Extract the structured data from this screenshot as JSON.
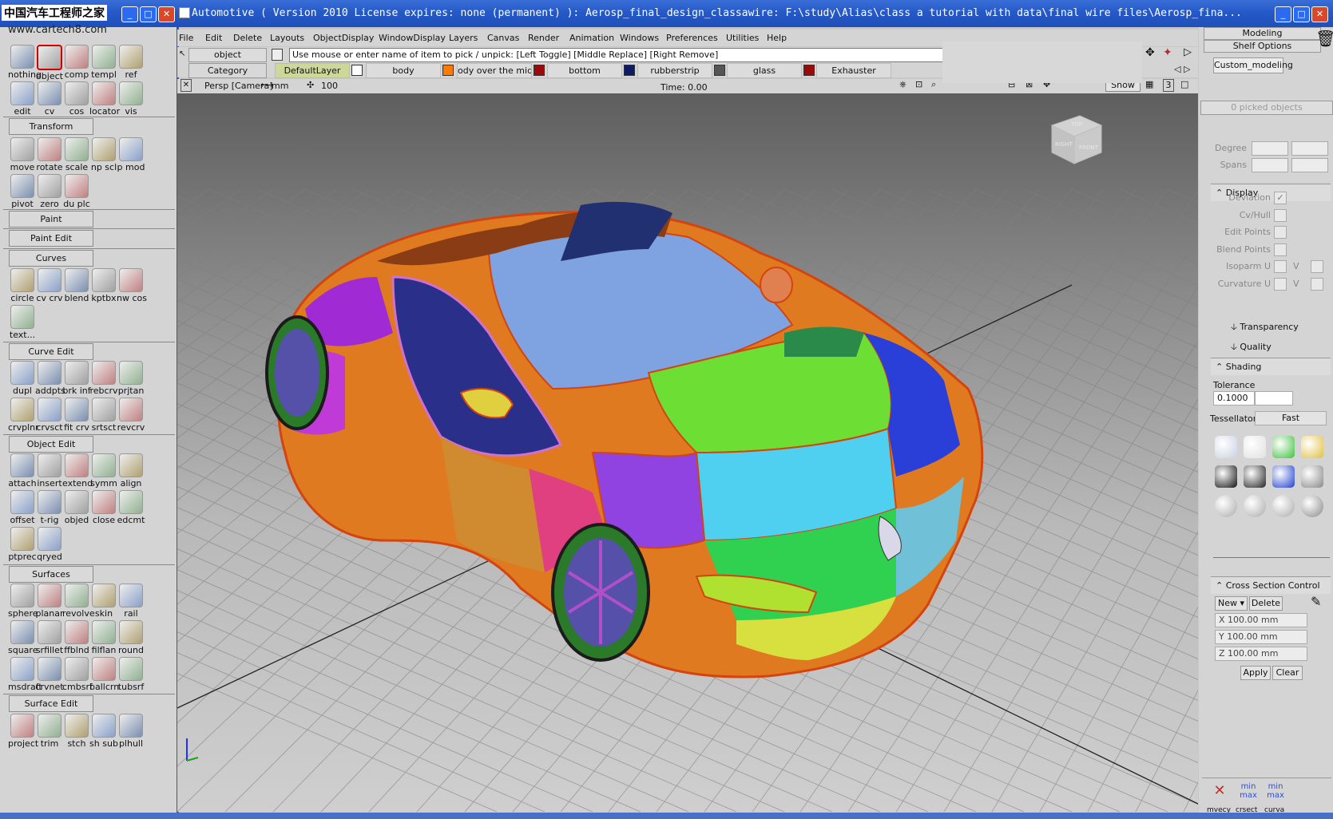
{
  "titlebar": {
    "site_logo": "中国汽车工程师之家",
    "site_url": "www.cartech8.com",
    "title": "Automotive ( Version 2010  License expires: none (permanent) ): Aerosp_final_design_classawire: F:\\study\\Alias\\class a tutorial with data\\final wire files\\Aerosp_fina...",
    "left_controls": [
      "_",
      "□",
      "✕"
    ],
    "right_controls": [
      "_",
      "□",
      "✕"
    ]
  },
  "menubar": [
    "File",
    "Edit",
    "Delete",
    "Layouts",
    "ObjectDisplay",
    "WindowDisplay",
    "Layers",
    "Canvas",
    "Render",
    "Animation",
    "Windows",
    "Preferences",
    "Utilities",
    "Help"
  ],
  "pickbar": {
    "pick_mode": "object",
    "prompt": "Use mouse or enter name of item to pick / unpick: [Left Toggle] [Middle Replace] [Right Remove]"
  },
  "layerbar": {
    "category_label": "Category",
    "layers": [
      {
        "name": "DefaultLayer",
        "color": "#ffffff"
      },
      {
        "name": "body",
        "color": "#ff7a00"
      },
      {
        "name": "ody over the middle",
        "color": "#9b0a0a"
      },
      {
        "name": "bottom",
        "color": "#0d1a66"
      },
      {
        "name": "rubberstrip",
        "color": "#555555"
      },
      {
        "name": "glass",
        "color": "#9b0a0a"
      },
      {
        "name": "Exhauster",
        "color": ""
      }
    ]
  },
  "viewbar": {
    "camera": "Persp [Camera]",
    "unit": "mm",
    "zoom": "100",
    "time": "Time: 0.00",
    "show_button": "Show",
    "page_number": "3"
  },
  "viewcube": {
    "top": "TOP",
    "right": "FRONT",
    "left": "RIGHT"
  },
  "shelf": {
    "groups": [
      {
        "tools": [
          "nothing",
          "object",
          "comp",
          "templ",
          "ref",
          "edit",
          "cv",
          "cos",
          "locator",
          "vis"
        ]
      },
      {
        "header": "Transform",
        "tools": [
          "move",
          "rotate",
          "scale",
          "np scl",
          "p mod",
          "pivot",
          "zero",
          "du plc"
        ]
      },
      {
        "header": "Paint",
        "tools": []
      },
      {
        "header": "Paint Edit",
        "tools": []
      },
      {
        "header": "Curves",
        "tools": [
          "circle",
          "cv crv",
          "blend",
          "kptbx",
          "nw cos",
          "text..."
        ]
      },
      {
        "header": "Curve Edit",
        "tools": [
          "dupl",
          "addpts",
          "brk inf",
          "rebcrv",
          "prjtan",
          "crvplnr",
          "crvsct",
          "fit crv",
          "srtsct",
          "revcrv"
        ]
      },
      {
        "header": "Object Edit",
        "tools": [
          "attach",
          "insert",
          "extend",
          "symm",
          "align",
          "offset",
          "t-rig",
          "objed",
          "close",
          "edcmt",
          "ptprec",
          "qryed"
        ]
      },
      {
        "header": "Surfaces",
        "tools": [
          "sphere",
          "planar",
          "revolve",
          "skin",
          "rail",
          "square",
          "srfillet",
          "ffblnd",
          "filflan",
          "round",
          "msdraft",
          "crvnet",
          "cmbsrf",
          "ballcrn",
          "tubsrf"
        ]
      },
      {
        "header": "Surface Edit",
        "tools": [
          "project",
          "trim",
          "stch",
          "sh sub",
          "plhull"
        ]
      }
    ]
  },
  "rpanel": {
    "tab_top": "Modeling",
    "tab_shelf": "Shelf Options",
    "custom_tab": "Custom_modeling",
    "picked": "0 picked objects",
    "degree_label": "Degree",
    "spans_label": "Spans",
    "display_header": "Display",
    "display_rows": [
      "Deviation",
      "Cv/Hull",
      "Edit Points",
      "Blend Points",
      "Isoparm U",
      "Curvature U"
    ],
    "v_label": "V",
    "transparency": "Transparency",
    "quality": "Quality",
    "shading_header": "Shading",
    "tolerance_label": "Tolerance",
    "tolerance_value": "0.1000",
    "tessellator_label": "Tessellator",
    "tessellator_value": "Fast",
    "cross_section_header": "Cross Section Control",
    "new_label": "New",
    "delete_label": "Delete",
    "x_value": "X 100.00 mm",
    "y_value": "Y 100.00 mm",
    "z_value": "Z 100.00 mm",
    "apply_label": "Apply",
    "clear_label": "Clear",
    "bottom_tools": [
      "mvecy",
      "crsect",
      "curva"
    ],
    "min_label": "min",
    "max_label": "max"
  }
}
